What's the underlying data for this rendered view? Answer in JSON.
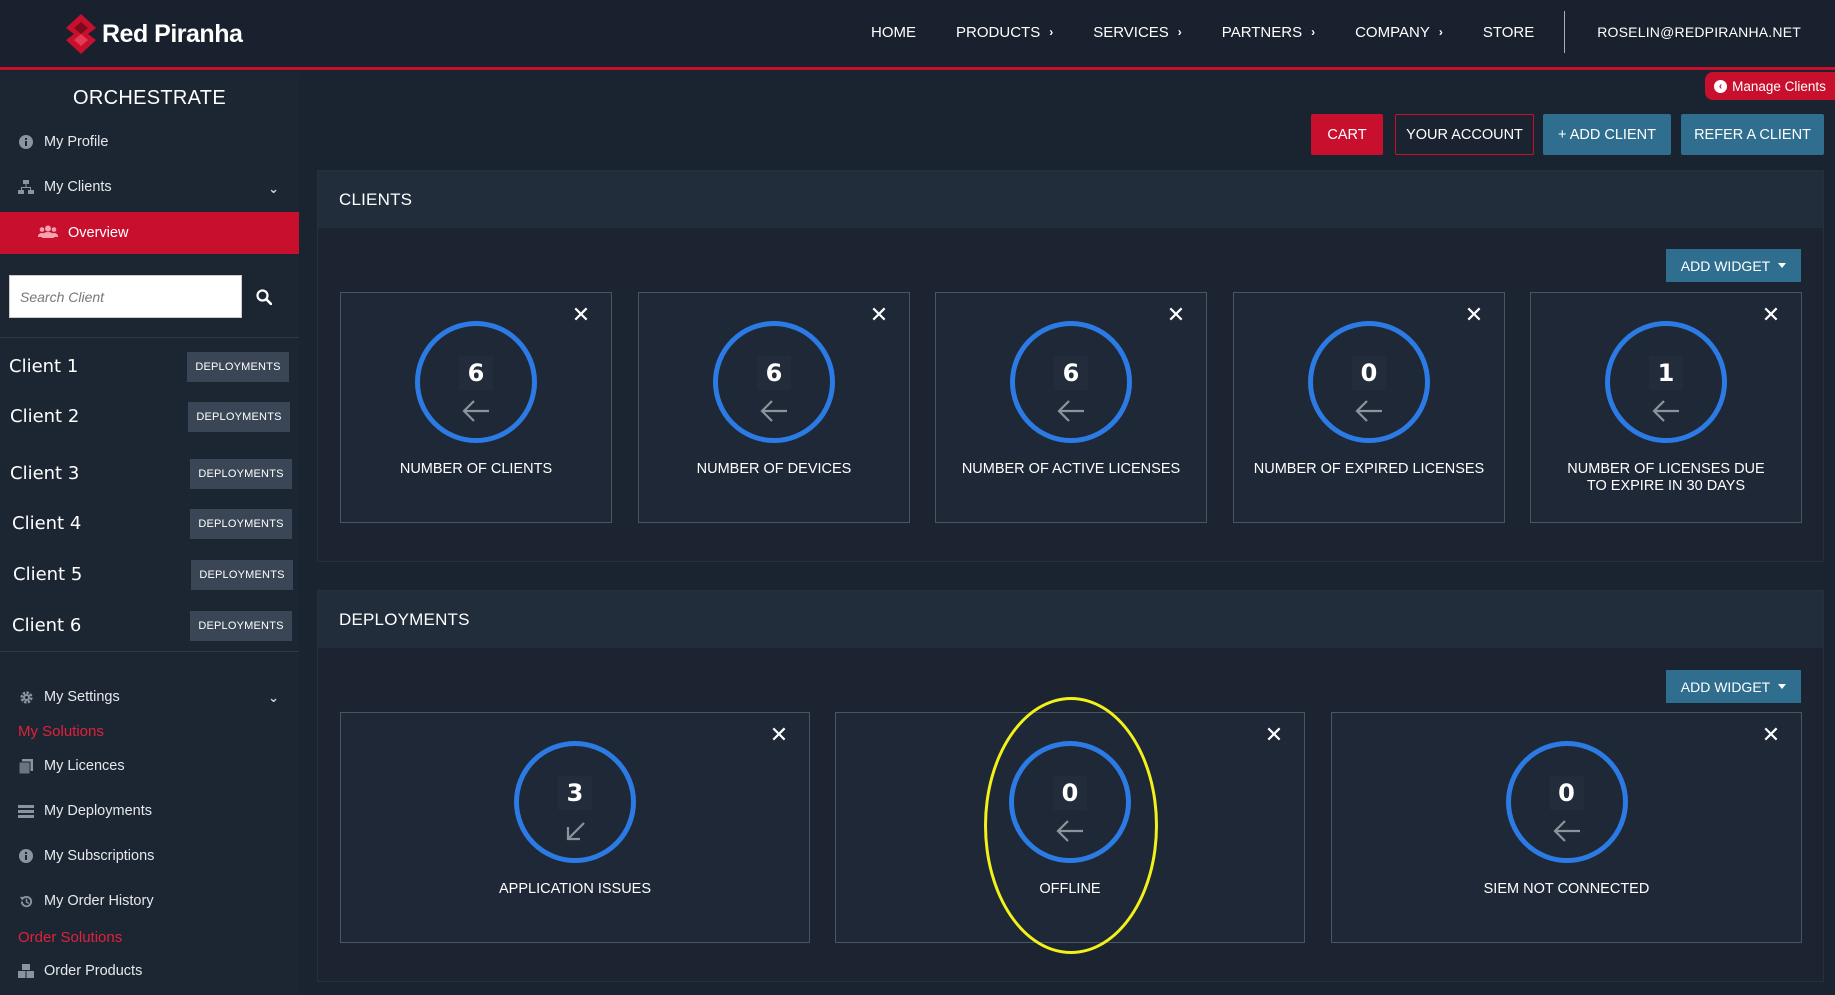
{
  "header": {
    "brand": "Red Piranha",
    "nav": [
      {
        "label": "HOME",
        "has_menu": false
      },
      {
        "label": "PRODUCTS",
        "has_menu": true
      },
      {
        "label": "SERVICES",
        "has_menu": true
      },
      {
        "label": "PARTNERS",
        "has_menu": true
      },
      {
        "label": "COMPANY",
        "has_menu": true
      },
      {
        "label": "STORE",
        "has_menu": false
      }
    ],
    "user": "ROSELIN@REDPIRANHA.NET"
  },
  "sidebar": {
    "title": "ORCHESTRATE",
    "my_profile": "My Profile",
    "my_clients": "My Clients",
    "overview": "Overview",
    "search_placeholder": "Search Client",
    "clients": [
      {
        "name": "Client 1",
        "action": "DEPLOYMENTS"
      },
      {
        "name": "Client 2",
        "action": "DEPLOYMENTS"
      },
      {
        "name": "Client 3",
        "action": "DEPLOYMENTS"
      },
      {
        "name": "Client 4",
        "action": "DEPLOYMENTS"
      },
      {
        "name": "Client 5",
        "action": "DEPLOYMENTS"
      },
      {
        "name": "Client 6",
        "action": "DEPLOYMENTS"
      }
    ],
    "my_settings": "My Settings",
    "my_solutions_heading": "My Solutions",
    "solutions": [
      {
        "label": "My Licences",
        "icon": "licence-icon"
      },
      {
        "label": "My Deployments",
        "icon": "deployments-icon"
      },
      {
        "label": "My Subscriptions",
        "icon": "info-icon"
      },
      {
        "label": "My Order History",
        "icon": "history-icon"
      }
    ],
    "order_solutions_heading": "Order Solutions",
    "order_products": "Order Products"
  },
  "main": {
    "manage_clients": "Manage Clients",
    "actions": {
      "cart": "CART",
      "your_account": "YOUR ACCOUNT",
      "add_client": "+ ADD CLIENT",
      "refer_client": "REFER A CLIENT"
    },
    "clients_panel": {
      "title": "CLIENTS",
      "add_widget": "ADD WIDGET",
      "widgets": [
        {
          "value": "6",
          "label": "NUMBER OF CLIENTS",
          "arrow": "left"
        },
        {
          "value": "6",
          "label": "NUMBER OF DEVICES",
          "arrow": "left"
        },
        {
          "value": "6",
          "label": "NUMBER OF ACTIVE LICENSES",
          "arrow": "left"
        },
        {
          "value": "0",
          "label": "NUMBER OF EXPIRED LICENSES",
          "arrow": "left"
        },
        {
          "value": "1",
          "label": "NUMBER OF LICENSES DUE TO EXPIRE IN 30 DAYS",
          "arrow": "left"
        }
      ]
    },
    "deployments_panel": {
      "title": "DEPLOYMENTS",
      "add_widget": "ADD WIDGET",
      "widgets": [
        {
          "value": "3",
          "label": "APPLICATION ISSUES",
          "arrow": "down-left"
        },
        {
          "value": "0",
          "label": "OFFLINE",
          "arrow": "left"
        },
        {
          "value": "0",
          "label": "SIEM NOT CONNECTED",
          "arrow": "left"
        }
      ]
    }
  },
  "colors": {
    "accent_red": "#c8102e",
    "ring_blue": "#2c7be5",
    "teal_button": "#2f6e8e",
    "highlight_yellow": "#f2f21a"
  }
}
